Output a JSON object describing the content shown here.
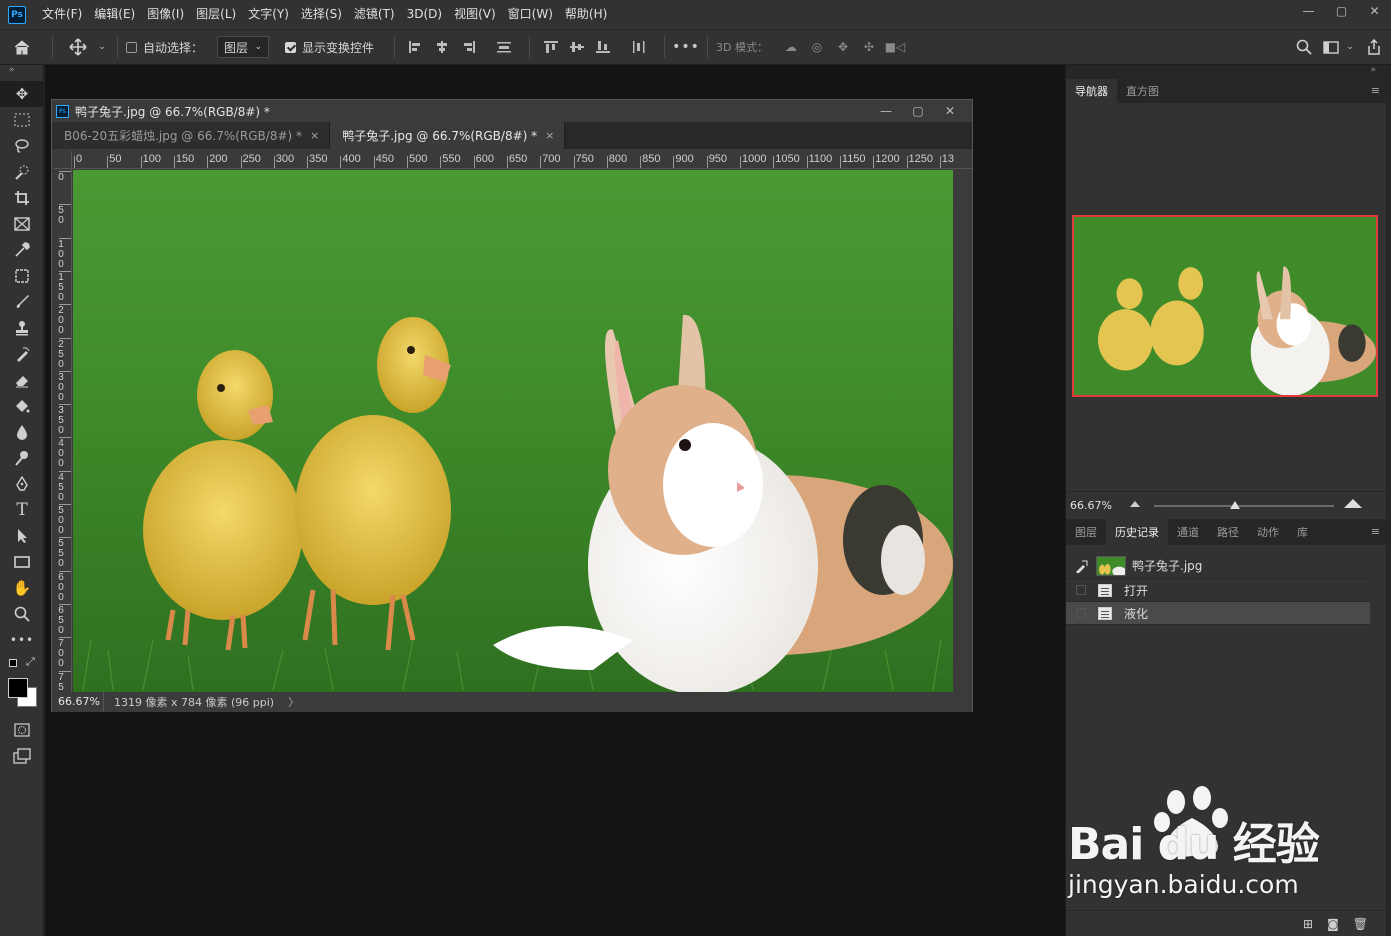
{
  "menubar": {
    "logo": "Ps",
    "items": [
      "文件(F)",
      "编辑(E)",
      "图像(I)",
      "图层(L)",
      "文字(Y)",
      "选择(S)",
      "滤镜(T)",
      "3D(D)",
      "视图(V)",
      "窗口(W)",
      "帮助(H)"
    ]
  },
  "options": {
    "auto_select_label": "自动选择：",
    "auto_select_checked": false,
    "layer_select_value": "图层",
    "show_transform_label": "显示变换控件",
    "show_transform_checked": true,
    "mode_3d_label": "3D 模式："
  },
  "document": {
    "window_title": "鸭子兔子.jpg @ 66.7%(RGB/8#) *",
    "tabs": [
      {
        "label": "B06-20五彩蜡烛.jpg @ 66.7%(RGB/8#) *",
        "active": false
      },
      {
        "label": "鸭子兔子.jpg @ 66.7%(RGB/8#) *",
        "active": true
      }
    ],
    "ruler_top": [
      "0",
      "50",
      "100",
      "150",
      "200",
      "250",
      "300",
      "350",
      "400",
      "450",
      "500",
      "550",
      "600",
      "650",
      "700",
      "750",
      "800",
      "850",
      "900",
      "950",
      "1000",
      "1050",
      "1100",
      "1150",
      "1200",
      "1250",
      "13"
    ],
    "ruler_left": [
      "0",
      "50",
      "100",
      "150",
      "200",
      "250",
      "300",
      "350",
      "400",
      "450",
      "500",
      "550",
      "600",
      "650",
      "700",
      "75"
    ],
    "status_zoom": "66.67%",
    "status_info": "1319 像素 x 784 像素 (96 ppi)",
    "status_arrow": "〉"
  },
  "navigator": {
    "tabs": [
      "导航器",
      "直方图"
    ],
    "zoom": "66.67%",
    "zoom_slider_fraction": 0.45
  },
  "history": {
    "tabs": [
      "图层",
      "历史记录",
      "通道",
      "路径",
      "动作",
      "库"
    ],
    "active_tab": "历史记录",
    "snapshot_label": "鸭子兔子.jpg",
    "items": [
      "打开",
      "液化"
    ],
    "selected_index": 1
  },
  "watermark": {
    "brand": "Bai du 经验",
    "url": "jingyan.baidu.com"
  },
  "colors": {
    "accent": "#31a8ff",
    "nav_frame": "#e33b3b",
    "grass": "#3e8a2a"
  }
}
